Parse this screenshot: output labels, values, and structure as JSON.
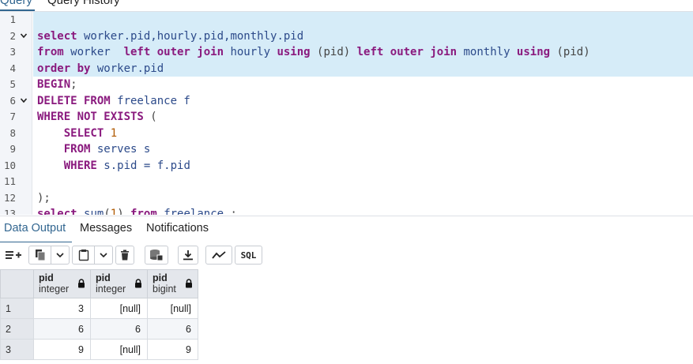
{
  "top_tabs": [
    {
      "label": "Query"
    },
    {
      "label": "Query History"
    }
  ],
  "editor": {
    "lines": [
      {
        "n": "1",
        "fold": false,
        "hl": true,
        "tokens": []
      },
      {
        "n": "2",
        "fold": true,
        "hl": true,
        "tokens": [
          [
            "kw",
            "select"
          ],
          [
            "id",
            " worker.pid,hourly.pid,monthly.pid"
          ]
        ]
      },
      {
        "n": "3",
        "fold": false,
        "hl": true,
        "tokens": [
          [
            "kw",
            "from"
          ],
          [
            "id",
            " worker  "
          ],
          [
            "kw",
            "left outer join"
          ],
          [
            "id",
            " hourly "
          ],
          [
            "kw",
            "using"
          ],
          [
            "op",
            " (pid) "
          ],
          [
            "kw",
            "left outer join"
          ],
          [
            "id",
            " monthly "
          ],
          [
            "kw",
            "using"
          ],
          [
            "op",
            " (pid)"
          ]
        ]
      },
      {
        "n": "4",
        "fold": false,
        "hl": true,
        "tokens": [
          [
            "kw",
            "order by"
          ],
          [
            "id",
            " worker.pid"
          ]
        ]
      },
      {
        "n": "5",
        "fold": false,
        "hl": false,
        "tokens": [
          [
            "kw",
            "BEGIN"
          ],
          [
            "op",
            ";"
          ]
        ]
      },
      {
        "n": "6",
        "fold": true,
        "hl": false,
        "tokens": [
          [
            "kw",
            "DELETE FROM"
          ],
          [
            "id",
            " freelance f"
          ]
        ]
      },
      {
        "n": "7",
        "fold": false,
        "hl": false,
        "tokens": [
          [
            "kw",
            "WHERE NOT EXISTS"
          ],
          [
            "op",
            " ("
          ]
        ]
      },
      {
        "n": "8",
        "fold": false,
        "hl": false,
        "tokens": [
          [
            "op",
            "    "
          ],
          [
            "kw",
            "SELECT"
          ],
          [
            "op",
            " "
          ],
          [
            "num",
            "1"
          ]
        ]
      },
      {
        "n": "9",
        "fold": false,
        "hl": false,
        "tokens": [
          [
            "op",
            "    "
          ],
          [
            "kw",
            "FROM"
          ],
          [
            "id",
            " serves s"
          ]
        ]
      },
      {
        "n": "10",
        "fold": false,
        "hl": false,
        "tokens": [
          [
            "op",
            "    "
          ],
          [
            "kw",
            "WHERE"
          ],
          [
            "id",
            " s.pid = f.pid"
          ]
        ]
      },
      {
        "n": "11",
        "fold": false,
        "hl": false,
        "tokens": []
      },
      {
        "n": "12",
        "fold": false,
        "hl": false,
        "tokens": [
          [
            "op",
            ");"
          ]
        ]
      },
      {
        "n": "13",
        "fold": false,
        "hl": false,
        "tokens": [
          [
            "kw",
            "select"
          ],
          [
            "op",
            " "
          ],
          [
            "id",
            "sum"
          ],
          [
            "op",
            "("
          ],
          [
            "num",
            "1"
          ],
          [
            "op",
            ") "
          ],
          [
            "kw",
            "from"
          ],
          [
            "id",
            " freelance"
          ],
          [
            "op",
            " ;"
          ]
        ]
      }
    ]
  },
  "output_tabs": [
    {
      "label": "Data Output"
    },
    {
      "label": "Messages"
    },
    {
      "label": "Notifications"
    }
  ],
  "toolbar": {
    "sql_label": "SQL",
    "icons": [
      "add-row-icon",
      "copy-icon",
      "chevron-down-icon",
      "paste-icon",
      "chevron-down-icon",
      "delete-icon",
      "save-data-icon",
      "download-icon",
      "graph-icon",
      "sql-icon"
    ]
  },
  "grid": {
    "columns": [
      {
        "name": "pid",
        "type": "integer"
      },
      {
        "name": "pid",
        "type": "integer"
      },
      {
        "name": "pid",
        "type": "bigint"
      }
    ],
    "rows": [
      {
        "n": "1",
        "cells": [
          "3",
          "[null]",
          "[null]"
        ]
      },
      {
        "n": "2",
        "cells": [
          "6",
          "6",
          "6"
        ]
      },
      {
        "n": "3",
        "cells": [
          "9",
          "[null]",
          "9"
        ]
      }
    ]
  },
  "colors": {
    "accent": "#326690",
    "keyword": "#8a1a7e",
    "identifier": "#2c4a8a",
    "highlight": "#d6ecf8"
  }
}
